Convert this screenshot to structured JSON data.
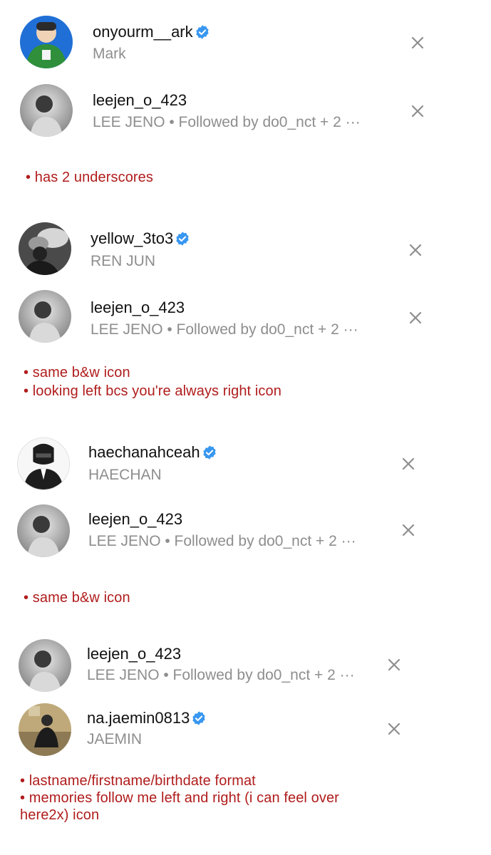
{
  "colors": {
    "verified": "#3897f0",
    "note_text": "#b01c1c",
    "secondary_text": "#8e8e8e"
  },
  "suggestions": [
    {
      "username": "onyourm__ark",
      "subtitle": "Mark",
      "verified": true,
      "avatar": "green-jacket-photo"
    },
    {
      "username": "leejen_o_423",
      "subtitle": "LEE JENO • Followed by do0_nct + 2 ···",
      "verified": false,
      "avatar": "bw-portrait"
    },
    {
      "username": "yellow_3to3",
      "subtitle": "REN JUN",
      "verified": true,
      "avatar": "bw-smoke-photo"
    },
    {
      "username": "leejen_o_423",
      "subtitle": "LEE JENO • Followed by do0_nct + 2 ···",
      "verified": false,
      "avatar": "bw-portrait"
    },
    {
      "username": "haechanahceah",
      "subtitle": "HAECHAN",
      "verified": true,
      "avatar": "helmet-illustration"
    },
    {
      "username": "leejen_o_423",
      "subtitle": "LEE JENO • Followed by do0_nct + 2 ···",
      "verified": false,
      "avatar": "bw-portrait"
    },
    {
      "username": "leejen_o_423",
      "subtitle": "LEE JENO • Followed by do0_nct + 2 ···",
      "verified": false,
      "avatar": "bw-portrait"
    },
    {
      "username": "na.jaemin0813",
      "subtitle": "JAEMIN",
      "verified": true,
      "avatar": "outdoor-photo"
    }
  ],
  "notes": [
    [
      "• has 2 underscores"
    ],
    [
      "• same b&w icon",
      "• looking left bcs you're always right icon"
    ],
    [
      "• same b&w icon"
    ],
    [
      "• lastname/firstname/birthdate format",
      "• memories follow me left and right (i can feel over",
      "here2x) icon"
    ]
  ]
}
